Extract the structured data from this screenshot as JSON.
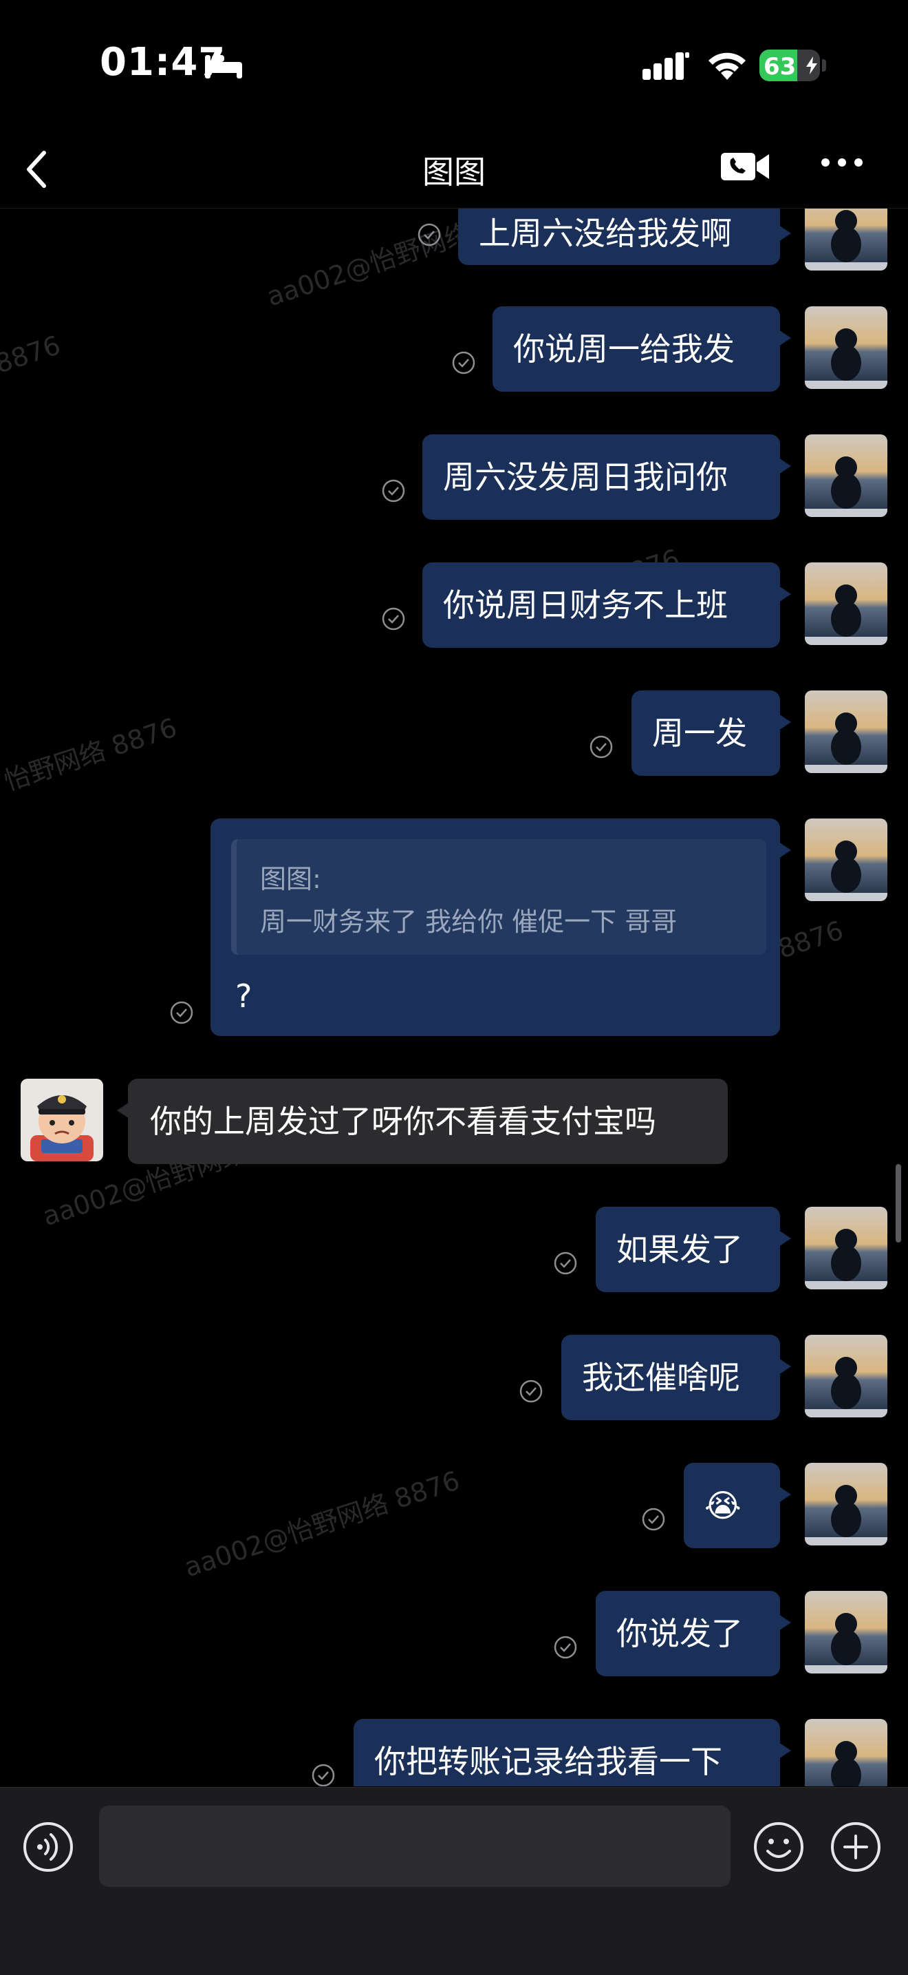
{
  "status_bar": {
    "time": "01:47",
    "battery": "63",
    "battery_level": 0.63
  },
  "nav": {
    "title": "图图"
  },
  "messages": [
    {
      "from": "me",
      "text": "上周六没给我发啊"
    },
    {
      "from": "me",
      "text": "你说周一给我发"
    },
    {
      "from": "me",
      "text": "周六没发周日我问你"
    },
    {
      "from": "me",
      "text": "你说周日财务不上班"
    },
    {
      "from": "me",
      "text": "周一发"
    },
    {
      "from": "me",
      "quote_name": "图图:",
      "quote_text": "周一财务来了  我给你 催促一下 哥哥",
      "text": "?"
    },
    {
      "from": "them",
      "text": "你的上周发过了呀你不看看支付宝吗"
    },
    {
      "from": "me",
      "text": "如果发了"
    },
    {
      "from": "me",
      "text": "我还催啥呢"
    },
    {
      "from": "me",
      "text": "😭"
    },
    {
      "from": "me",
      "text": "你说发了"
    },
    {
      "from": "me",
      "text": "你把转账记录给我看一下"
    }
  ],
  "watermarks": [
    "aa002@怡野网络 8876",
    "8876",
    "怡野网络 8876",
    "8876",
    "aa002@怡野网络 8876",
    "aa002@怡野网络 8876",
    "8876"
  ],
  "input": {
    "placeholder": ""
  },
  "colors": {
    "outgoing_bubble": "#1b3058",
    "incoming_bubble": "#2c2c2e",
    "background": "#000000",
    "battery": "#34c759"
  }
}
